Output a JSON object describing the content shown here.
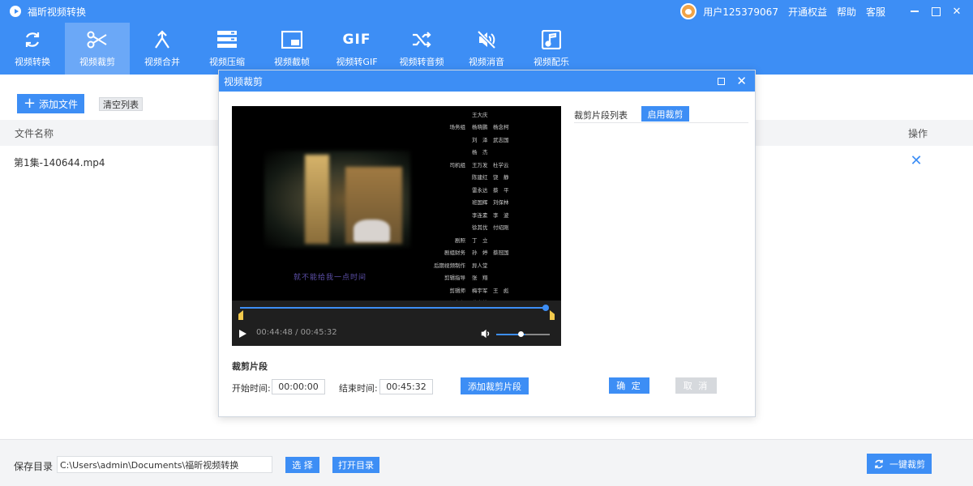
{
  "app": {
    "title": "福昕视频转换",
    "user": "用户125379067",
    "links": [
      "开通权益",
      "帮助",
      "客服"
    ]
  },
  "toolbar": {
    "tools": [
      {
        "label": "视频转换",
        "icon": "refresh-icon"
      },
      {
        "label": "视频裁剪",
        "icon": "scissors-icon",
        "active": true
      },
      {
        "label": "视频合并",
        "icon": "merge-icon"
      },
      {
        "label": "视频压缩",
        "icon": "compress-icon"
      },
      {
        "label": "视频截帧",
        "icon": "screen-icon"
      },
      {
        "label": "视频转GIF",
        "icon": "gif-icon"
      },
      {
        "label": "视频转音频",
        "icon": "shuffle-icon"
      },
      {
        "label": "视频消音",
        "icon": "mute-icon"
      },
      {
        "label": "视频配乐",
        "icon": "music-icon"
      }
    ]
  },
  "main": {
    "add_file": "添加文件",
    "clear_list": "清空列表",
    "col_name": "文件名称",
    "col_op": "操作",
    "files": [
      {
        "name": "第1集-140644.mp4"
      }
    ]
  },
  "footer": {
    "save_label": "保存目录",
    "path": "C:\\Users\\admin\\Documents\\福昕视频转换",
    "choose": "选 择",
    "open_dir": "打开目录",
    "one_key": "一键裁剪"
  },
  "dialog": {
    "title": "视频裁剪",
    "video": {
      "subtitle": "就不能给我一点时间",
      "time": "00:44:48 / 00:45:32",
      "progress_fraction": 0.984,
      "volume_fraction": 0.55,
      "credits": [
        {
          "role": "",
          "names": "王大庆"
        },
        {
          "role": "场务组",
          "names": "杨晓鹏　杨念柯"
        },
        {
          "role": "",
          "names": "刘　泽　武志国"
        },
        {
          "role": "",
          "names": "杨　杰"
        },
        {
          "role": "司机组",
          "names": "王万发　杜学云"
        },
        {
          "role": "",
          "names": "陈建红　饶　静"
        },
        {
          "role": "",
          "names": "雷永达　蔡　平"
        },
        {
          "role": "",
          "names": "班国辉　刘保林"
        },
        {
          "role": "",
          "names": "李连素　李　波"
        },
        {
          "role": "",
          "names": "徐其优　付绍刚"
        },
        {
          "role": "剧照",
          "names": "丁　立"
        },
        {
          "role": "剧组财务",
          "names": "孙　婷　蔡冠国"
        },
        {
          "role": "后期视频制作",
          "names": "异人堂"
        },
        {
          "role": "剪辑指导",
          "names": "张　翔"
        },
        {
          "role": "剪辑师",
          "names": "梅宇军　王　彪"
        },
        {
          "role": "调色师",
          "names": "龚光雄"
        }
      ]
    },
    "segment_list": "裁剪片段列表",
    "enable": "启用裁剪",
    "segment_title": "裁剪片段",
    "start_label": "开始时间:",
    "start_value": "00:00:00",
    "end_label": "结束时间:",
    "end_value": "00:45:32",
    "add_segment": "添加裁剪片段",
    "ok": "确 定",
    "cancel": "取 消"
  }
}
